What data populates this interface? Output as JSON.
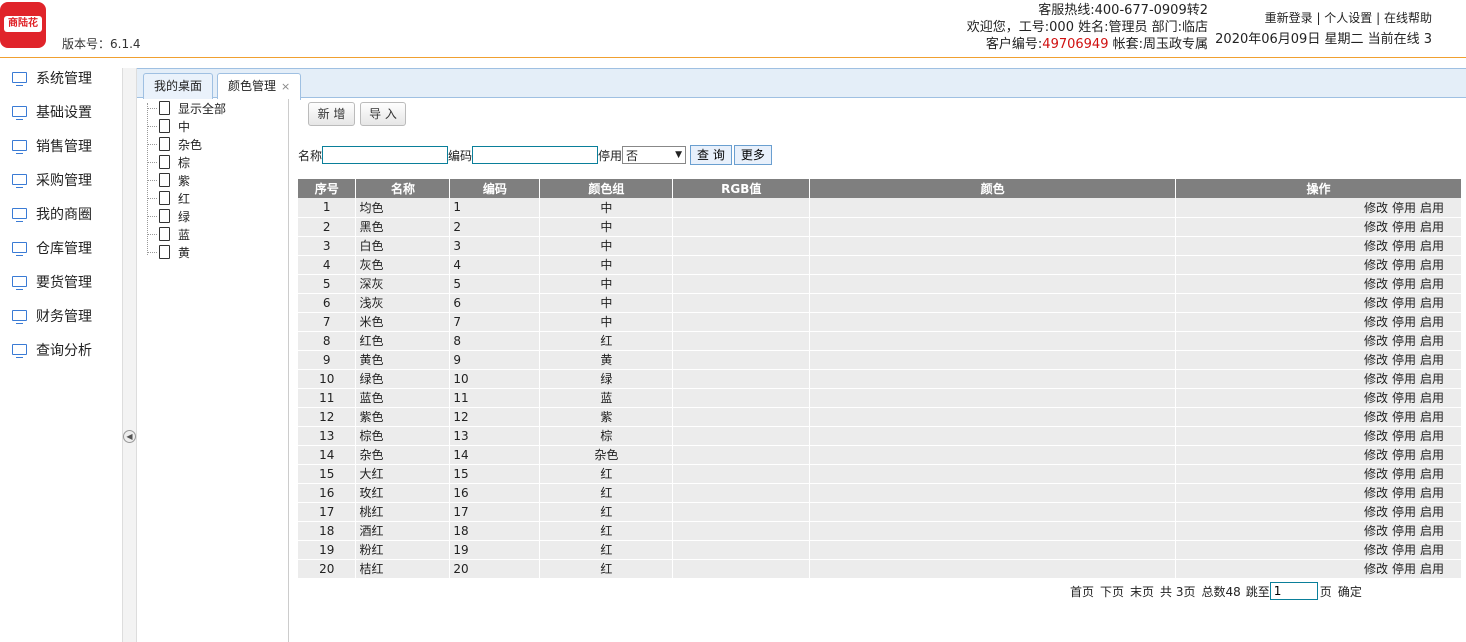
{
  "header": {
    "logo_text": "商陆花",
    "version": "版本号：6.1.4",
    "hotline": "客服热线:400-677-0909转2",
    "welcome": "欢迎您，工号:000 姓名:管理员 部门:临店",
    "customer_label": "客户编号:",
    "customer_no": "49706949",
    "account": "帐套:周玉政专属",
    "links": [
      "重新登录",
      "个人设置",
      "在线帮助"
    ],
    "date_line": "2020年06月09日 星期二 当前在线 3"
  },
  "nav": {
    "items": [
      {
        "label": "系统管理"
      },
      {
        "label": "基础设置"
      },
      {
        "label": "销售管理"
      },
      {
        "label": "采购管理"
      },
      {
        "label": "我的商圈"
      },
      {
        "label": "仓库管理"
      },
      {
        "label": "要货管理"
      },
      {
        "label": "财务管理"
      },
      {
        "label": "查询分析"
      }
    ]
  },
  "tabs": [
    {
      "label": "我的桌面"
    },
    {
      "label": "颜色管理",
      "close": "×"
    }
  ],
  "tree": {
    "items": [
      "显示全部",
      "中",
      "杂色",
      "棕",
      "紫",
      "红",
      "绿",
      "蓝",
      "黄"
    ]
  },
  "toolbar": {
    "add_label": "新 增",
    "import_label": "导 入"
  },
  "filter": {
    "name_label": "名称",
    "code_label": "编码",
    "disabled_label": "停用",
    "disabled_value": "否",
    "query_label": "查 询",
    "more_label": "更多"
  },
  "table": {
    "columns": [
      "序号",
      "名称",
      "编码",
      "颜色组",
      "RGB值",
      "颜色",
      "操作"
    ],
    "actions": [
      "修改",
      "停用",
      "启用"
    ],
    "rows": [
      {
        "no": "1",
        "name": "均色",
        "code": "1",
        "group": "中"
      },
      {
        "no": "2",
        "name": "黑色",
        "code": "2",
        "group": "中"
      },
      {
        "no": "3",
        "name": "白色",
        "code": "3",
        "group": "中"
      },
      {
        "no": "4",
        "name": "灰色",
        "code": "4",
        "group": "中"
      },
      {
        "no": "5",
        "name": "深灰",
        "code": "5",
        "group": "中"
      },
      {
        "no": "6",
        "name": "浅灰",
        "code": "6",
        "group": "中"
      },
      {
        "no": "7",
        "name": "米色",
        "code": "7",
        "group": "中"
      },
      {
        "no": "8",
        "name": "红色",
        "code": "8",
        "group": "红"
      },
      {
        "no": "9",
        "name": "黄色",
        "code": "9",
        "group": "黄"
      },
      {
        "no": "10",
        "name": "绿色",
        "code": "10",
        "group": "绿"
      },
      {
        "no": "11",
        "name": "蓝色",
        "code": "11",
        "group": "蓝"
      },
      {
        "no": "12",
        "name": "紫色",
        "code": "12",
        "group": "紫"
      },
      {
        "no": "13",
        "name": "棕色",
        "code": "13",
        "group": "棕"
      },
      {
        "no": "14",
        "name": "杂色",
        "code": "14",
        "group": "杂色"
      },
      {
        "no": "15",
        "name": "大红",
        "code": "15",
        "group": "红"
      },
      {
        "no": "16",
        "name": "玫红",
        "code": "16",
        "group": "红"
      },
      {
        "no": "17",
        "name": "桃红",
        "code": "17",
        "group": "红"
      },
      {
        "no": "18",
        "name": "酒红",
        "code": "18",
        "group": "红"
      },
      {
        "no": "19",
        "name": "粉红",
        "code": "19",
        "group": "红"
      },
      {
        "no": "20",
        "name": "桔红",
        "code": "20",
        "group": "红"
      }
    ]
  },
  "pager": {
    "first": "首页",
    "next": "下页",
    "last": "末页",
    "total_pages": "共 3页",
    "total_count": "总数48",
    "jump_label": "跳至",
    "page_value": "1",
    "page_unit": "页",
    "confirm": "确定"
  },
  "colors": {
    "accent_border": "#f0a030",
    "logo_red": "#e0242a",
    "table_header": "#7f7f7f",
    "row_bg": "#ececec"
  }
}
